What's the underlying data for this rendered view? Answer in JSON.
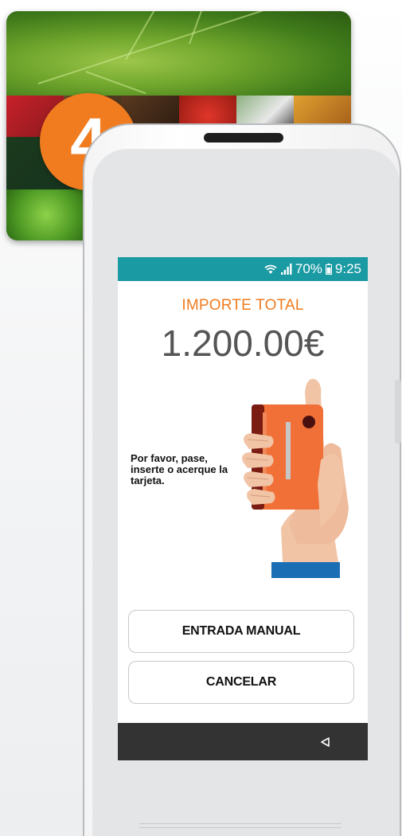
{
  "step_badge": "4",
  "status_bar": {
    "battery": "70%",
    "time": "9:25"
  },
  "payment": {
    "title": "IMPORTE TOTAL",
    "amount": "1.200.00€",
    "instruction": "Por favor, pase, inserte o acerque la tarjeta."
  },
  "buttons": {
    "manual_entry": "ENTRADA MANUAL",
    "cancel": "CANCELAR"
  },
  "colors": {
    "accent": "#f07c1f",
    "status_bar": "#1a9aa3",
    "nav_bar": "#333333",
    "card": "#f07038"
  },
  "icons": [
    "wifi-icon",
    "signal-icon",
    "battery-icon",
    "hand-card-illustration",
    "back-icon"
  ]
}
